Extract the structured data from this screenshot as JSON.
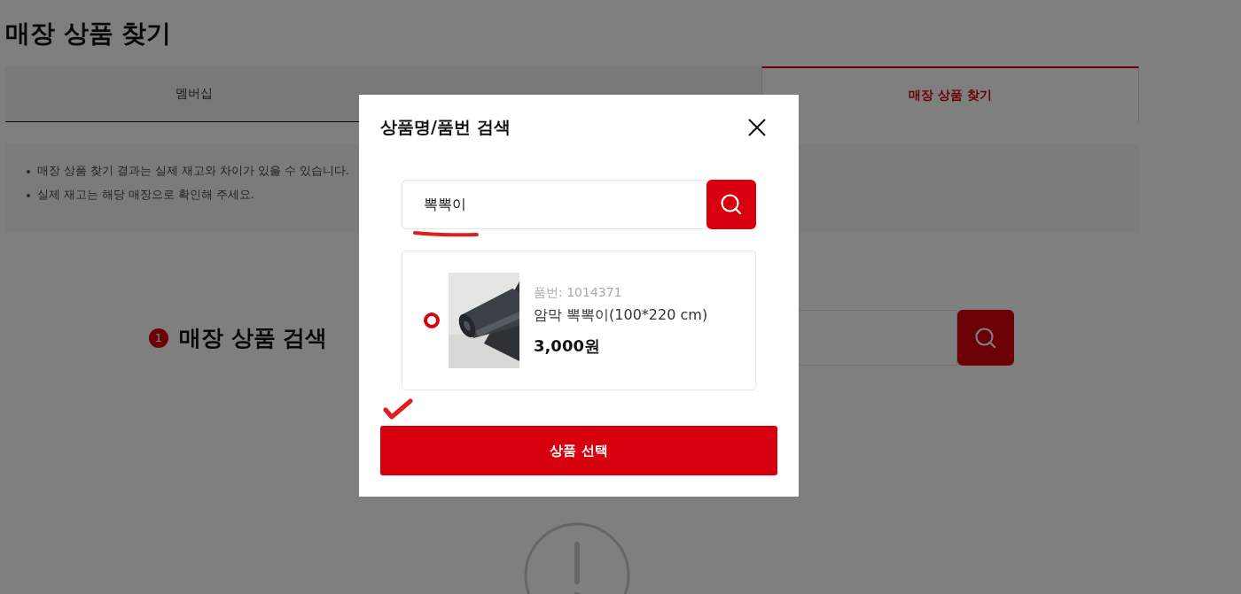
{
  "page": {
    "title": "매장 상품 찾기"
  },
  "tabs": [
    {
      "label": "멤버십",
      "selected": false
    },
    {
      "selected": false
    },
    {
      "label": "매장 상품 찾기",
      "selected": true
    }
  ],
  "notices": [
    "매장 상품 찾기 결과는 실제 재고와 차이가 있을 수 있습니다.",
    "실제 재고는 해당 매장으로 확인해 주세요."
  ],
  "section": {
    "step": "1",
    "title": "매장 상품 검색"
  },
  "modal": {
    "title": "상품명/품번 검색",
    "search": {
      "value": "뽁뽁이"
    },
    "results": [
      {
        "code": "품번: 1014371",
        "name": "암막 뽁뽁이(100*220 cm)",
        "price": "3,000원",
        "selected": true
      }
    ],
    "confirm_button": "상품 선택"
  }
}
